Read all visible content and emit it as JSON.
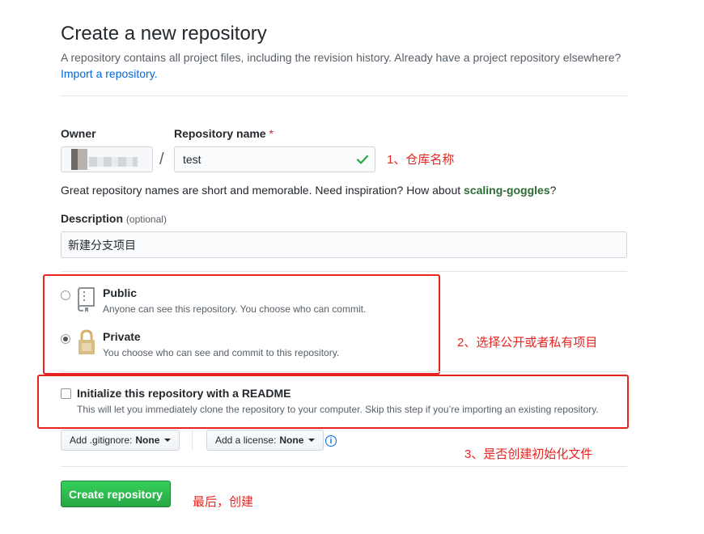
{
  "header": {
    "title": "Create a new repository",
    "subtitle": "A repository contains all project files, including the revision history. Already have a project repository elsewhere?",
    "import_link": "Import a repository."
  },
  "owner": {
    "label": "Owner"
  },
  "repo_name": {
    "label": "Repository name",
    "required_mark": "*",
    "value": "test"
  },
  "name_hint": {
    "prefix": "Great repository names are short and memorable. Need inspiration? How about ",
    "suggestion": "scaling-goggles",
    "suffix": "?"
  },
  "description": {
    "label": "Description",
    "optional": "(optional)",
    "value": "新建分支项目"
  },
  "visibility": {
    "public": {
      "title": "Public",
      "desc": "Anyone can see this repository. You choose who can commit."
    },
    "private": {
      "title": "Private",
      "desc": "You choose who can see and commit to this repository."
    },
    "selected": "private"
  },
  "readme": {
    "title": "Initialize this repository with a README",
    "desc": "This will let you immediately clone the repository to your computer. Skip this step if you’re importing an existing repository."
  },
  "gitignore": {
    "prefix": "Add .gitignore:",
    "value": "None"
  },
  "license": {
    "prefix": "Add a license:",
    "value": "None"
  },
  "create_button": "Create repository",
  "annotations": {
    "a1": "1、仓库名称",
    "a2": "2、选择公开或者私有项目",
    "a3": "3、是否创建初始化文件",
    "a4": "最后，创建"
  },
  "colors": {
    "annotation": "#e8231f",
    "primary": "#28a745",
    "link": "#0366d6"
  },
  "icons": {
    "check": "check-icon",
    "public": "repo-book-icon",
    "private": "lock-icon",
    "info": "info-icon"
  }
}
